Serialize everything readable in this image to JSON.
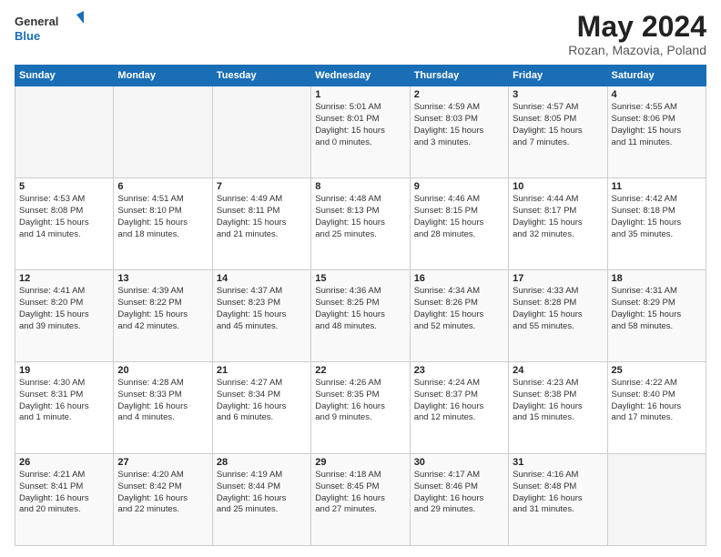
{
  "header": {
    "logo_line1": "General",
    "logo_line2": "Blue",
    "title": "May 2024",
    "subtitle": "Rozan, Mazovia, Poland"
  },
  "calendar": {
    "days_of_week": [
      "Sunday",
      "Monday",
      "Tuesday",
      "Wednesday",
      "Thursday",
      "Friday",
      "Saturday"
    ],
    "weeks": [
      [
        {
          "day": "",
          "info": ""
        },
        {
          "day": "",
          "info": ""
        },
        {
          "day": "",
          "info": ""
        },
        {
          "day": "1",
          "info": "Sunrise: 5:01 AM\nSunset: 8:01 PM\nDaylight: 15 hours\nand 0 minutes."
        },
        {
          "day": "2",
          "info": "Sunrise: 4:59 AM\nSunset: 8:03 PM\nDaylight: 15 hours\nand 3 minutes."
        },
        {
          "day": "3",
          "info": "Sunrise: 4:57 AM\nSunset: 8:05 PM\nDaylight: 15 hours\nand 7 minutes."
        },
        {
          "day": "4",
          "info": "Sunrise: 4:55 AM\nSunset: 8:06 PM\nDaylight: 15 hours\nand 11 minutes."
        }
      ],
      [
        {
          "day": "5",
          "info": "Sunrise: 4:53 AM\nSunset: 8:08 PM\nDaylight: 15 hours\nand 14 minutes."
        },
        {
          "day": "6",
          "info": "Sunrise: 4:51 AM\nSunset: 8:10 PM\nDaylight: 15 hours\nand 18 minutes."
        },
        {
          "day": "7",
          "info": "Sunrise: 4:49 AM\nSunset: 8:11 PM\nDaylight: 15 hours\nand 21 minutes."
        },
        {
          "day": "8",
          "info": "Sunrise: 4:48 AM\nSunset: 8:13 PM\nDaylight: 15 hours\nand 25 minutes."
        },
        {
          "day": "9",
          "info": "Sunrise: 4:46 AM\nSunset: 8:15 PM\nDaylight: 15 hours\nand 28 minutes."
        },
        {
          "day": "10",
          "info": "Sunrise: 4:44 AM\nSunset: 8:17 PM\nDaylight: 15 hours\nand 32 minutes."
        },
        {
          "day": "11",
          "info": "Sunrise: 4:42 AM\nSunset: 8:18 PM\nDaylight: 15 hours\nand 35 minutes."
        }
      ],
      [
        {
          "day": "12",
          "info": "Sunrise: 4:41 AM\nSunset: 8:20 PM\nDaylight: 15 hours\nand 39 minutes."
        },
        {
          "day": "13",
          "info": "Sunrise: 4:39 AM\nSunset: 8:22 PM\nDaylight: 15 hours\nand 42 minutes."
        },
        {
          "day": "14",
          "info": "Sunrise: 4:37 AM\nSunset: 8:23 PM\nDaylight: 15 hours\nand 45 minutes."
        },
        {
          "day": "15",
          "info": "Sunrise: 4:36 AM\nSunset: 8:25 PM\nDaylight: 15 hours\nand 48 minutes."
        },
        {
          "day": "16",
          "info": "Sunrise: 4:34 AM\nSunset: 8:26 PM\nDaylight: 15 hours\nand 52 minutes."
        },
        {
          "day": "17",
          "info": "Sunrise: 4:33 AM\nSunset: 8:28 PM\nDaylight: 15 hours\nand 55 minutes."
        },
        {
          "day": "18",
          "info": "Sunrise: 4:31 AM\nSunset: 8:29 PM\nDaylight: 15 hours\nand 58 minutes."
        }
      ],
      [
        {
          "day": "19",
          "info": "Sunrise: 4:30 AM\nSunset: 8:31 PM\nDaylight: 16 hours\nand 1 minute."
        },
        {
          "day": "20",
          "info": "Sunrise: 4:28 AM\nSunset: 8:33 PM\nDaylight: 16 hours\nand 4 minutes."
        },
        {
          "day": "21",
          "info": "Sunrise: 4:27 AM\nSunset: 8:34 PM\nDaylight: 16 hours\nand 6 minutes."
        },
        {
          "day": "22",
          "info": "Sunrise: 4:26 AM\nSunset: 8:35 PM\nDaylight: 16 hours\nand 9 minutes."
        },
        {
          "day": "23",
          "info": "Sunrise: 4:24 AM\nSunset: 8:37 PM\nDaylight: 16 hours\nand 12 minutes."
        },
        {
          "day": "24",
          "info": "Sunrise: 4:23 AM\nSunset: 8:38 PM\nDaylight: 16 hours\nand 15 minutes."
        },
        {
          "day": "25",
          "info": "Sunrise: 4:22 AM\nSunset: 8:40 PM\nDaylight: 16 hours\nand 17 minutes."
        }
      ],
      [
        {
          "day": "26",
          "info": "Sunrise: 4:21 AM\nSunset: 8:41 PM\nDaylight: 16 hours\nand 20 minutes."
        },
        {
          "day": "27",
          "info": "Sunrise: 4:20 AM\nSunset: 8:42 PM\nDaylight: 16 hours\nand 22 minutes."
        },
        {
          "day": "28",
          "info": "Sunrise: 4:19 AM\nSunset: 8:44 PM\nDaylight: 16 hours\nand 25 minutes."
        },
        {
          "day": "29",
          "info": "Sunrise: 4:18 AM\nSunset: 8:45 PM\nDaylight: 16 hours\nand 27 minutes."
        },
        {
          "day": "30",
          "info": "Sunrise: 4:17 AM\nSunset: 8:46 PM\nDaylight: 16 hours\nand 29 minutes."
        },
        {
          "day": "31",
          "info": "Sunrise: 4:16 AM\nSunset: 8:48 PM\nDaylight: 16 hours\nand 31 minutes."
        },
        {
          "day": "",
          "info": ""
        }
      ]
    ]
  }
}
